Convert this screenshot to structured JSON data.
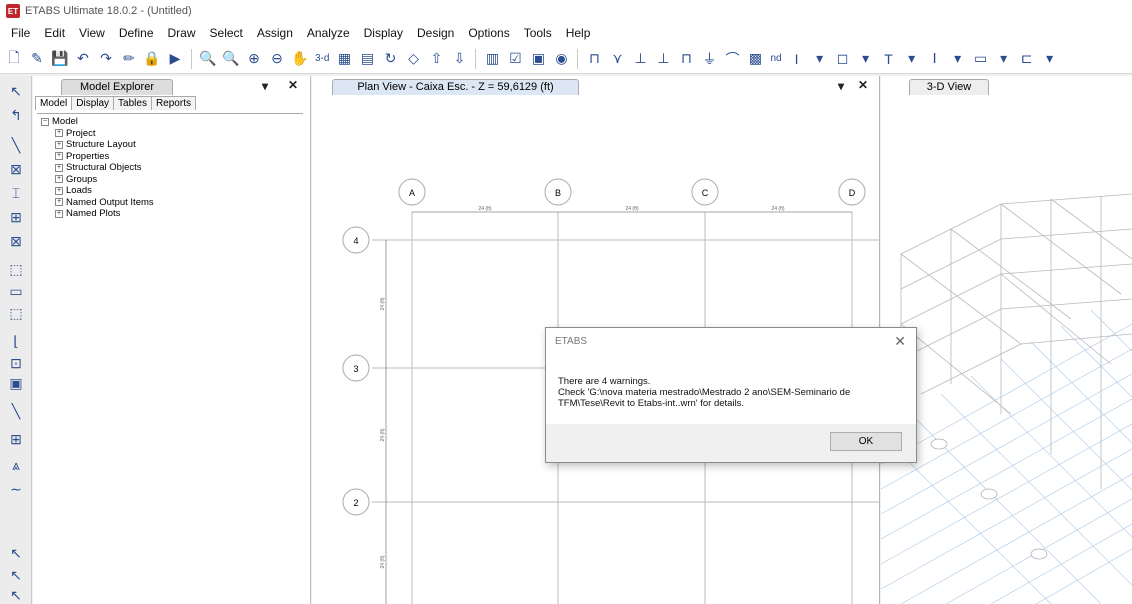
{
  "window": {
    "title": "ETABS Ultimate 18.0.2 - (Untitled)",
    "icon_label": "ET"
  },
  "menu": [
    "File",
    "Edit",
    "View",
    "Define",
    "Draw",
    "Select",
    "Assign",
    "Analyze",
    "Display",
    "Design",
    "Options",
    "Tools",
    "Help"
  ],
  "toolbar": {
    "text_3d": "3-d",
    "text_nd": "nd"
  },
  "explorer": {
    "title": "Model Explorer",
    "tabs": [
      "Model",
      "Display",
      "Tables",
      "Reports"
    ],
    "root": "Model",
    "items": [
      "Project",
      "Structure Layout",
      "Properties",
      "Structural Objects",
      "Groups",
      "Loads",
      "Named Output Items",
      "Named Plots"
    ]
  },
  "plan_view": {
    "title": "Plan View - Caixa Esc. - Z = 59,6129 (ft)",
    "grid_columns": [
      "A",
      "B",
      "C",
      "D"
    ],
    "grid_rows": [
      "4",
      "3",
      "2"
    ],
    "spacing_label": "24 (ft)"
  },
  "view3d": {
    "title": "3-D View"
  },
  "dialog": {
    "title": "ETABS",
    "message_line1": "There are 4 warnings.",
    "message_line2": "Check 'G:\\nova materia mestrado\\Mestrado 2 ano\\SEM-Seminario de TFM\\Tese\\Revit to Etabs-int..wrn' for details.",
    "ok_label": "OK"
  },
  "colors": {
    "accent": "#2a4d8f",
    "app_icon": "#c0272d",
    "grid_blue": "#9fc3e6"
  }
}
